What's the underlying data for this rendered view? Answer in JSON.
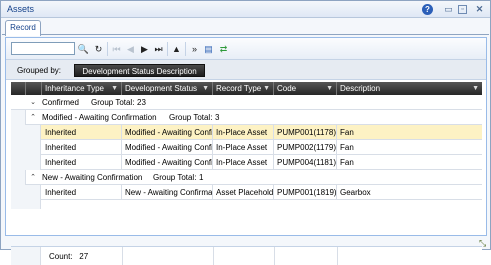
{
  "window": {
    "title": "Assets"
  },
  "titlebar_icons": [
    "help-icon",
    "minimize-icon",
    "restore-icon",
    "close-icon"
  ],
  "tabs": [
    {
      "label": "Record"
    }
  ],
  "toolbar": {
    "search_value": "",
    "search_placeholder": "",
    "buttons": [
      "search-icon",
      "refresh-icon",
      "first-page-icon",
      "prev-page-icon",
      "next-page-icon",
      "last-page-icon",
      "up-icon",
      "expand-all-icon",
      "export-icon",
      "sync-icon"
    ]
  },
  "grouping": {
    "label": "Grouped by:",
    "field": "Development Status Description"
  },
  "columns": [
    {
      "label": "Inheritance Type"
    },
    {
      "label": "Development Status"
    },
    {
      "label": "Record Type"
    },
    {
      "label": "Code"
    },
    {
      "label": "Description"
    }
  ],
  "groups": {
    "confirmed": {
      "label": "Confirmed",
      "total_label": "Group Total:",
      "total": "23"
    },
    "modified": {
      "label": "Modified - Awaiting Confirmation",
      "total_label": "Group Total:",
      "total": "3"
    },
    "new": {
      "label": "New - Awaiting Confirmation",
      "total_label": "Group Total:",
      "total": "1"
    }
  },
  "rows": [
    {
      "inheritance": "Inherited",
      "status": "Modified - Awaiting Confi",
      "record_type": "In-Place Asset",
      "code": "PUMP001(1178)",
      "description": "Fan",
      "selected": true
    },
    {
      "inheritance": "Inherited",
      "status": "Modified - Awaiting Confi",
      "record_type": "In-Place Asset",
      "code": "PUMP002(1179)",
      "description": "Fan"
    },
    {
      "inheritance": "Inherited",
      "status": "Modified - Awaiting Confi",
      "record_type": "In-Place Asset",
      "code": "PUMP004(1181)",
      "description": "Fan"
    },
    {
      "inheritance": "Inherited",
      "status": "New - Awaiting Confirma",
      "record_type": "Asset Placeholde",
      "code": "PUMP001(1819)",
      "description": "Gearbox"
    }
  ],
  "footer": {
    "count_label": "Count:",
    "count": "27"
  },
  "colors": {
    "header_bg": "#262626",
    "selected_row": "#fdf2c4",
    "title_text": "#15428b"
  }
}
